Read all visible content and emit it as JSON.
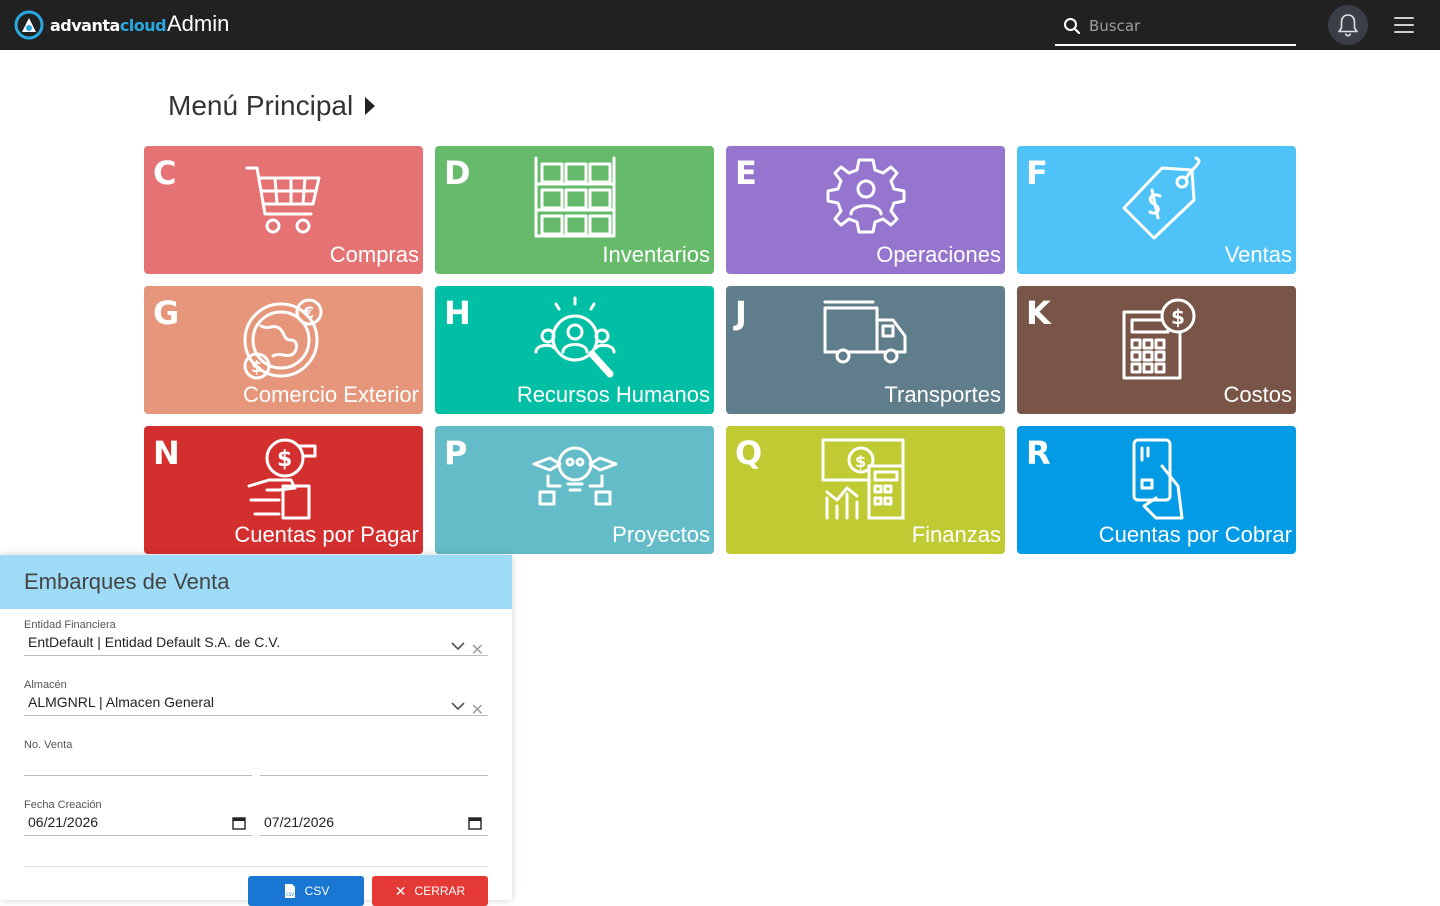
{
  "header": {
    "logo_word1": "advanta",
    "logo_word2": "cloud",
    "title": "Admin",
    "search_placeholder": "Buscar"
  },
  "main": {
    "title": "Menú Principal",
    "tiles": [
      {
        "letter": "C",
        "label": "Compras",
        "color": "#e57373",
        "icon": "shopping-cart-icon"
      },
      {
        "letter": "D",
        "label": "Inventarios",
        "color": "#66bb6a",
        "icon": "warehouse-boxes-icon"
      },
      {
        "letter": "E",
        "label": "Operaciones",
        "color": "#9575cd",
        "icon": "gear-person-icon"
      },
      {
        "letter": "F",
        "label": "Ventas",
        "color": "#4fc3f7",
        "icon": "price-tag-icon"
      },
      {
        "letter": "G",
        "label": "Comercio Exterior",
        "color": "#e5967b",
        "icon": "globe-currency-icon"
      },
      {
        "letter": "H",
        "label": "Recursos Humanos",
        "color": "#00bfa5",
        "icon": "people-search-icon"
      },
      {
        "letter": "J",
        "label": "Transportes",
        "color": "#607d8b",
        "icon": "truck-icon"
      },
      {
        "letter": "K",
        "label": "Costos",
        "color": "#795548",
        "icon": "calculator-coin-icon"
      },
      {
        "letter": "N",
        "label": "Cuentas por Pagar",
        "color": "#d32f2f",
        "icon": "hand-payment-icon"
      },
      {
        "letter": "P",
        "label": "Proyectos",
        "color": "#64bcc8",
        "icon": "idea-bulb-icon"
      },
      {
        "letter": "Q",
        "label": "Finanzas",
        "color": "#c0ca33",
        "icon": "finance-chart-icon"
      },
      {
        "letter": "R",
        "label": "Cuentas por Cobrar",
        "color": "#039be5",
        "icon": "card-hand-icon"
      }
    ]
  },
  "panel": {
    "title": "Embarques de Venta",
    "entidad_label": "Entidad Financiera",
    "entidad_value": "EntDefault | Entidad Default S.A. de C.V.",
    "almacen_label": "Almacén",
    "almacen_value": "ALMGNRL | Almacen General",
    "venta_label": "No. Venta",
    "venta_from": "",
    "venta_to": "",
    "fecha_label": "Fecha Creación",
    "fecha_from": "06/21/2026",
    "fecha_to": "07/21/2026",
    "csv_label": "CSV",
    "close_label": "CERRAR"
  }
}
